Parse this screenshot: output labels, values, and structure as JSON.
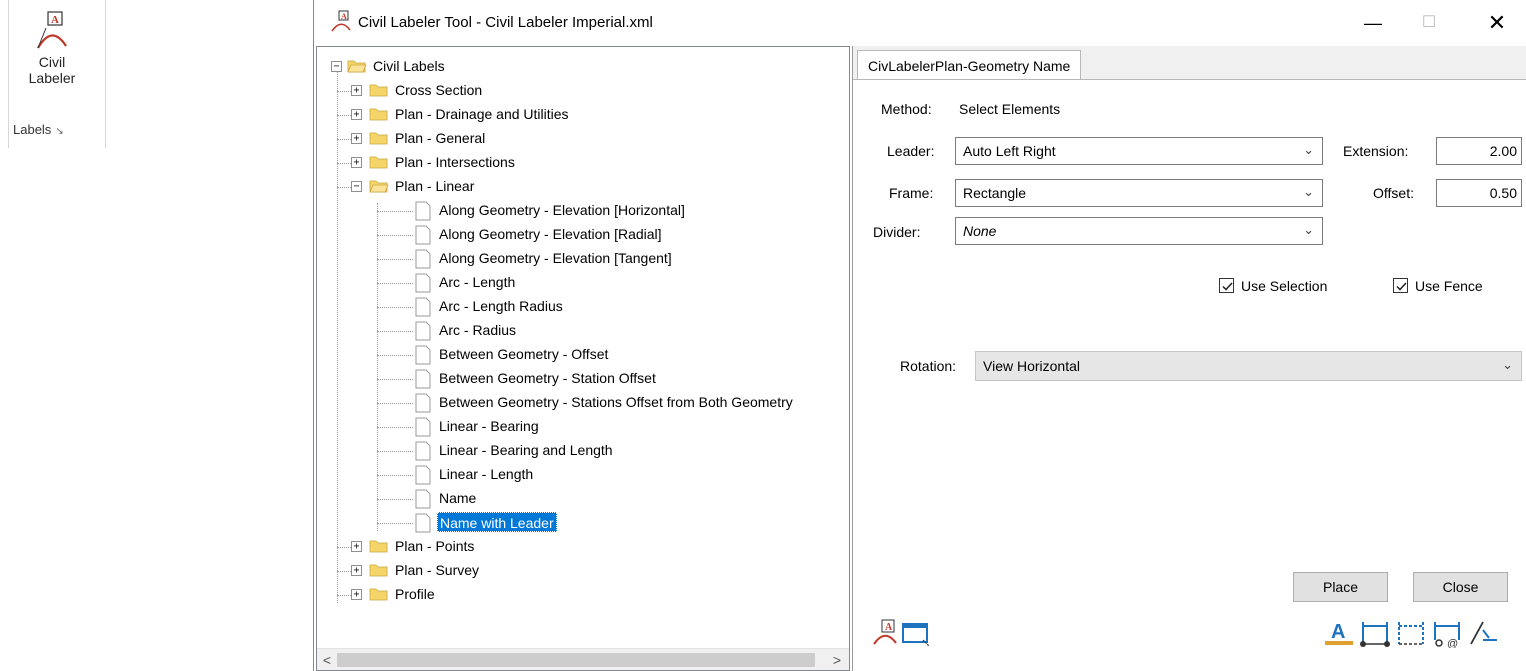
{
  "ribbon": {
    "button_label_1": "Civil",
    "button_label_2": "Labeler",
    "group_label": "Labels",
    "launcher_glyph": "↘"
  },
  "window": {
    "title": "Civil Labeler Tool - Civil Labeler Imperial.xml",
    "minimize_glyph": "—",
    "maximize_glyph": "☐",
    "close_glyph": "✕"
  },
  "tree": {
    "root": "Civil Labels",
    "items": [
      {
        "label": "Cross Section",
        "expander": "+"
      },
      {
        "label": "Plan - Drainage and Utilities",
        "expander": "+"
      },
      {
        "label": "Plan - General",
        "expander": "+"
      },
      {
        "label": "Plan - Intersections",
        "expander": "+"
      },
      {
        "label": "Plan - Linear",
        "expander": "−"
      },
      {
        "label": "Along Geometry - Elevation [Horizontal]"
      },
      {
        "label": "Along Geometry - Elevation [Radial]"
      },
      {
        "label": "Along Geometry - Elevation [Tangent]"
      },
      {
        "label": "Arc - Length"
      },
      {
        "label": "Arc - Length Radius"
      },
      {
        "label": "Arc - Radius"
      },
      {
        "label": "Between Geometry - Offset"
      },
      {
        "label": "Between Geometry - Station Offset"
      },
      {
        "label": "Between Geometry - Stations Offset from Both Geometry"
      },
      {
        "label": "Linear - Bearing"
      },
      {
        "label": "Linear - Bearing and Length"
      },
      {
        "label": "Linear - Length"
      },
      {
        "label": "Name"
      },
      {
        "label": "Name with Leader",
        "selected": true
      },
      {
        "label": "Plan - Points",
        "expander": "+"
      },
      {
        "label": "Plan - Survey",
        "expander": "+"
      },
      {
        "label": "Profile",
        "expander": "+"
      }
    ],
    "scroll_left": "<",
    "scroll_right": ">"
  },
  "panel": {
    "tab": "CivLabelerPlan-Geometry Name",
    "method_label": "Method:",
    "method_value": "Select Elements",
    "leader_label": "Leader:",
    "leader_value": "Auto Left Right",
    "frame_label": "Frame:",
    "frame_value": "Rectangle",
    "divider_label": "Divider:",
    "divider_value": "None",
    "extension_label": "Extension:",
    "extension_value": "2.00",
    "offset_label": "Offset:",
    "offset_value": "0.50",
    "use_selection": "Use Selection",
    "use_fence": "Use Fence",
    "rotation_label": "Rotation:",
    "rotation_value": "View Horizontal",
    "place_button": "Place",
    "close_button": "Close",
    "chevron": "⌄"
  },
  "colors": {
    "selection": "#0078d7",
    "accent_red": "#c0392b",
    "icon_blue": "#1e73be"
  }
}
